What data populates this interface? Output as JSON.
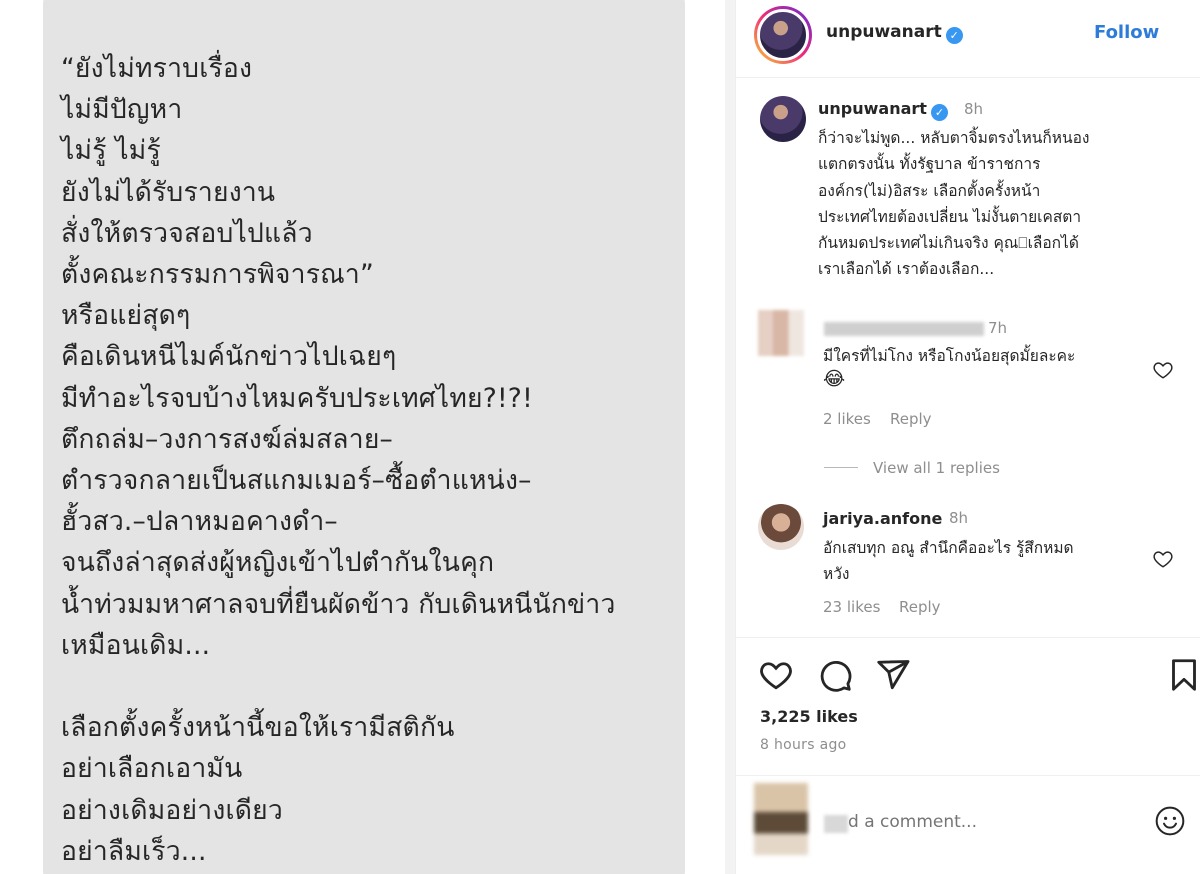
{
  "post_image": {
    "lines": [
      "“ยังไม่ทราบเรื่อง",
      "ไม่มีปัญหา",
      "ไม่รู้   ไม่รู้",
      "ยังไม่ได้รับรายงาน",
      "สั่งให้ตรวจสอบไปแล้ว",
      "ตั้งคณะกรรมการพิจารณา”",
      "หรือแย่สุดๆ",
      "คือเดินหนีไมค์นักข่าวไปเฉยๆ",
      "มีทำอะไรจบบ้างไหมครับประเทศไทย?!?!",
      "ตึกถล่ม–วงการสงฆ์ล่มสลาย–",
      "ตำรวจกลายเป็นสแกมเมอร์–ซื้อตำแหน่ง–",
      "ฮั้วสว.–ปลาหมอคางดำ–",
      "จนถึงล่าสุดส่งผู้หญิงเข้าไปตำกันในคุก",
      "น้ำท่วมมหาศาลจบที่ยืนผัดข้าว   กับเดินหนีนักข่าว",
      "เหมือนเดิม...",
      "",
      "เลือกตั้งครั้งหน้านี้ขอให้เรามีสติกัน",
      "อย่าเลือกเอามัน",
      "อย่างเดิมอย่างเดียว",
      "อย่าลืมเร็ว..."
    ]
  },
  "header": {
    "username": "unpuwanart",
    "verified_mark": "✓",
    "follow_label": "Follow"
  },
  "caption": {
    "username": "unpuwanart",
    "time": "8h",
    "text": "ก็ว่าจะไม่พูด...  หลับตาจิ้มตรงไหนก็หนอง\nแตกตรงนั้น ทั้งรัฐบาล ข้าราชการ\nองค์กร(ไม่)อิสระ  เลือกตั้งครั้งหน้า\nประเทศไทยต้องเปลี่ยน ไม่งั้นตายเคสตา\nกันหมดประเทศไม่เกินจริง  คุณ⎕เลือกได้\nเราเลือกได้ เราต้องเลือก..."
  },
  "comments": [
    {
      "time": "7h",
      "text": "มีใครที่ไม่โกง หรือโกงน้อยสุดมั้ยละคะ",
      "emoji": "😂",
      "likes": "2 likes",
      "reply": "Reply",
      "view_replies": "View all 1 replies"
    },
    {
      "username": "jariya.anfone",
      "time": "8h",
      "text": "อักเสบทุก อณู สำนึกคืออะไร รู้สึกหมด\nหวัง",
      "likes": "23 likes",
      "reply": "Reply"
    }
  ],
  "actions": {
    "icons": [
      "heart-icon",
      "comment-icon",
      "share-icon",
      "bookmark-icon"
    ],
    "likes": "3,225 likes",
    "time_ago": "8 hours ago"
  },
  "comment_box": {
    "placeholder": "d a comment..."
  },
  "colors": {
    "accent": "#2d7cd8",
    "verified": "#3897f0",
    "muted": "#8e8e8e",
    "image_bg": "#e4e4e4"
  }
}
